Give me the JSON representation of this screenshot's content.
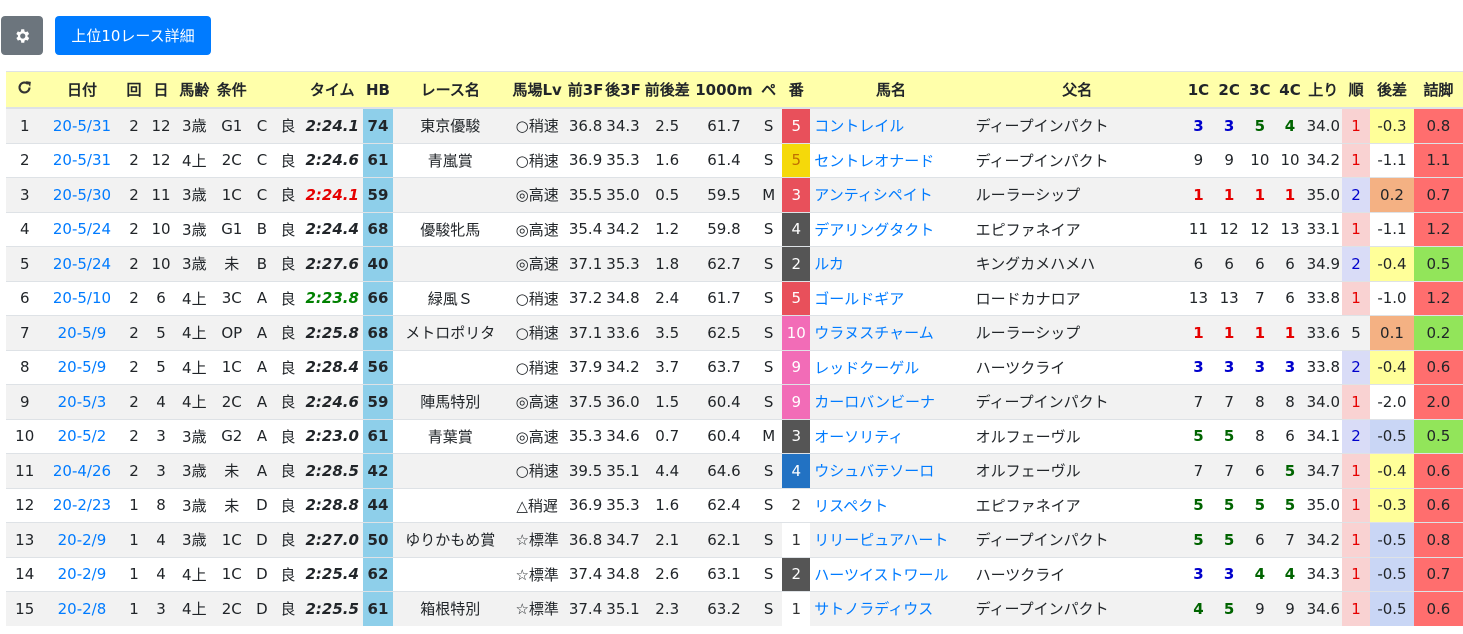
{
  "toolbar": {
    "settings_icon": "gear-icon",
    "top10_label": "上位10レース詳細"
  },
  "colors": {
    "header_bg": "#ffffaa",
    "hb_bg": "#8ecfea",
    "primary": "#007bff",
    "secondary": "#6c757d",
    "waku": {
      "1": "#ffffff",
      "2": "#555555",
      "3": "#e8505b",
      "4": "#2272c3",
      "5": "#f5d90a",
      "6": "#2e9e3f",
      "7": "#f59a1e",
      "8": "#f26cb7"
    }
  },
  "table": {
    "headers": [
      "",
      "日付",
      "回",
      "日",
      "馬齢",
      "条件",
      "",
      "",
      "タイム",
      "HB",
      "レース名",
      "馬場Lv",
      "前3F",
      "後3F",
      "前後差",
      "1000m",
      "ペ",
      "番",
      "馬名",
      "父名",
      "1C",
      "2C",
      "3C",
      "4C",
      "上り",
      "順",
      "後差",
      "詰脚"
    ],
    "refresh_icon": "refresh-icon",
    "rows": [
      {
        "no": "1",
        "date": "20-5/31",
        "kai": "2",
        "day": "12",
        "age": "3歳",
        "cond": "G1",
        "cls": "C",
        "track": "良",
        "time": "2:24.1",
        "time_color": "",
        "hb": "74",
        "race": "東京優駿",
        "baba": "○稍速",
        "f3": "36.8",
        "l3": "34.3",
        "diff": "2.5",
        "m1000": "61.7",
        "pace": "S",
        "ban": "5",
        "waku": "3",
        "horse": "コントレイル",
        "sire": "ディープインパクト",
        "c1": "3",
        "c2": "3",
        "c3": "5",
        "c4": "4",
        "cc": [
          "b",
          "b",
          "g",
          "g"
        ],
        "agari": "34.0",
        "jun": "1",
        "sa": "-0.3",
        "sa_color": "#ffff99",
        "tsume": "0.8",
        "tsume_color": "#ff6e6e"
      },
      {
        "no": "2",
        "date": "20-5/31",
        "kai": "2",
        "day": "12",
        "age": "4上",
        "cond": "2C",
        "cls": "C",
        "track": "良",
        "time": "2:24.6",
        "time_color": "",
        "hb": "61",
        "race": "青嵐賞",
        "baba": "○稍速",
        "f3": "36.9",
        "l3": "35.3",
        "diff": "1.6",
        "m1000": "61.4",
        "pace": "S",
        "ban": "5",
        "waku": "5",
        "horse": "セントレオナード",
        "sire": "ディープインパクト",
        "c1": "9",
        "c2": "9",
        "c3": "10",
        "c4": "10",
        "cc": [
          "",
          "",
          "",
          ""
        ],
        "agari": "34.2",
        "jun": "1",
        "sa": "-1.1",
        "sa_color": "#ffffff",
        "tsume": "1.1",
        "tsume_color": "#ff6e6e"
      },
      {
        "no": "3",
        "date": "20-5/30",
        "kai": "2",
        "day": "11",
        "age": "3歳",
        "cond": "1C",
        "cls": "C",
        "track": "良",
        "time": "2:24.1",
        "time_color": "red",
        "hb": "59",
        "race": "",
        "baba": "◎高速",
        "f3": "35.5",
        "l3": "35.0",
        "diff": "0.5",
        "m1000": "59.5",
        "pace": "M",
        "ban": "3",
        "waku": "3",
        "horse": "アンティシペイト",
        "sire": "ルーラーシップ",
        "c1": "1",
        "c2": "1",
        "c3": "1",
        "c4": "1",
        "cc": [
          "r",
          "r",
          "r",
          "r"
        ],
        "agari": "35.0",
        "jun": "2",
        "sa": "0.2",
        "sa_color": "#f4b183",
        "tsume": "0.7",
        "tsume_color": "#ff6e6e"
      },
      {
        "no": "4",
        "date": "20-5/24",
        "kai": "2",
        "day": "10",
        "age": "3歳",
        "cond": "G1",
        "cls": "B",
        "track": "良",
        "time": "2:24.4",
        "time_color": "",
        "hb": "68",
        "race": "優駿牝馬",
        "baba": "◎高速",
        "f3": "35.4",
        "l3": "34.2",
        "diff": "1.2",
        "m1000": "59.8",
        "pace": "S",
        "ban": "4",
        "waku": "2",
        "horse": "デアリングタクト",
        "sire": "エピファネイア",
        "c1": "11",
        "c2": "12",
        "c3": "12",
        "c4": "13",
        "cc": [
          "",
          "",
          "",
          ""
        ],
        "agari": "33.1",
        "jun": "1",
        "sa": "-1.1",
        "sa_color": "#ffffff",
        "tsume": "1.2",
        "tsume_color": "#ff6e6e"
      },
      {
        "no": "5",
        "date": "20-5/24",
        "kai": "2",
        "day": "10",
        "age": "3歳",
        "cond": "未",
        "cls": "B",
        "track": "良",
        "time": "2:27.6",
        "time_color": "",
        "hb": "40",
        "race": "",
        "baba": "◎高速",
        "f3": "37.1",
        "l3": "35.3",
        "diff": "1.8",
        "m1000": "62.7",
        "pace": "S",
        "ban": "2",
        "waku": "2",
        "horse": "ルカ",
        "sire": "キングカメハメハ",
        "c1": "6",
        "c2": "6",
        "c3": "6",
        "c4": "6",
        "cc": [
          "",
          "",
          "",
          ""
        ],
        "agari": "34.9",
        "jun": "2",
        "sa": "-0.4",
        "sa_color": "#ffff99",
        "tsume": "0.5",
        "tsume_color": "#92e55a"
      },
      {
        "no": "6",
        "date": "20-5/10",
        "kai": "2",
        "day": "6",
        "age": "4上",
        "cond": "3C",
        "cls": "A",
        "track": "良",
        "time": "2:23.8",
        "time_color": "green",
        "hb": "66",
        "race": "緑風Ｓ",
        "baba": "○稍速",
        "f3": "37.2",
        "l3": "34.8",
        "diff": "2.4",
        "m1000": "61.7",
        "pace": "S",
        "ban": "5",
        "waku": "3",
        "horse": "ゴールドギア",
        "sire": "ロードカナロア",
        "c1": "13",
        "c2": "13",
        "c3": "7",
        "c4": "6",
        "cc": [
          "",
          "",
          "",
          ""
        ],
        "agari": "33.8",
        "jun": "1",
        "sa": "-1.0",
        "sa_color": "#ffffff",
        "tsume": "1.2",
        "tsume_color": "#ff6e6e"
      },
      {
        "no": "7",
        "date": "20-5/9",
        "kai": "2",
        "day": "5",
        "age": "4上",
        "cond": "OP",
        "cls": "A",
        "track": "良",
        "time": "2:25.8",
        "time_color": "",
        "hb": "68",
        "race": "メトロポリタ",
        "baba": "○稍速",
        "f3": "37.1",
        "l3": "33.6",
        "diff": "3.5",
        "m1000": "62.5",
        "pace": "S",
        "ban": "10",
        "waku": "8",
        "horse": "ウラヌスチャーム",
        "sire": "ルーラーシップ",
        "c1": "1",
        "c2": "1",
        "c3": "1",
        "c4": "1",
        "cc": [
          "r",
          "r",
          "r",
          "r"
        ],
        "agari": "33.6",
        "jun": "5",
        "sa": "0.1",
        "sa_color": "#f4b183",
        "tsume": "0.2",
        "tsume_color": "#92e55a"
      },
      {
        "no": "8",
        "date": "20-5/9",
        "kai": "2",
        "day": "5",
        "age": "4上",
        "cond": "1C",
        "cls": "A",
        "track": "良",
        "time": "2:28.4",
        "time_color": "",
        "hb": "56",
        "race": "",
        "baba": "○稍速",
        "f3": "37.9",
        "l3": "34.2",
        "diff": "3.7",
        "m1000": "63.7",
        "pace": "S",
        "ban": "9",
        "waku": "8",
        "horse": "レッドクーゲル",
        "sire": "ハーツクライ",
        "c1": "3",
        "c2": "3",
        "c3": "3",
        "c4": "3",
        "cc": [
          "b",
          "b",
          "b",
          "b"
        ],
        "agari": "33.8",
        "jun": "2",
        "sa": "-0.4",
        "sa_color": "#ffff99",
        "tsume": "0.6",
        "tsume_color": "#ff6e6e"
      },
      {
        "no": "9",
        "date": "20-5/3",
        "kai": "2",
        "day": "4",
        "age": "4上",
        "cond": "2C",
        "cls": "A",
        "track": "良",
        "time": "2:24.6",
        "time_color": "",
        "hb": "59",
        "race": "陣馬特別",
        "baba": "◎高速",
        "f3": "37.5",
        "l3": "36.0",
        "diff": "1.5",
        "m1000": "60.4",
        "pace": "S",
        "ban": "9",
        "waku": "8",
        "horse": "カーロバンビーナ",
        "sire": "ディープインパクト",
        "c1": "7",
        "c2": "7",
        "c3": "8",
        "c4": "8",
        "cc": [
          "",
          "",
          "",
          ""
        ],
        "agari": "34.0",
        "jun": "1",
        "sa": "-2.0",
        "sa_color": "#ffffff",
        "tsume": "2.0",
        "tsume_color": "#ff6e6e"
      },
      {
        "no": "10",
        "date": "20-5/2",
        "kai": "2",
        "day": "3",
        "age": "3歳",
        "cond": "G2",
        "cls": "A",
        "track": "良",
        "time": "2:23.0",
        "time_color": "",
        "hb": "61",
        "race": "青葉賞",
        "baba": "◎高速",
        "f3": "35.3",
        "l3": "34.6",
        "diff": "0.7",
        "m1000": "60.4",
        "pace": "M",
        "ban": "3",
        "waku": "2",
        "horse": "オーソリティ",
        "sire": "オルフェーヴル",
        "c1": "5",
        "c2": "5",
        "c3": "8",
        "c4": "6",
        "cc": [
          "g",
          "g",
          "",
          ""
        ],
        "agari": "34.1",
        "jun": "2",
        "sa": "-0.5",
        "sa_color": "#c9d6f5",
        "tsume": "0.5",
        "tsume_color": "#92e55a"
      },
      {
        "no": "11",
        "date": "20-4/26",
        "kai": "2",
        "day": "3",
        "age": "3歳",
        "cond": "未",
        "cls": "A",
        "track": "良",
        "time": "2:28.5",
        "time_color": "",
        "hb": "42",
        "race": "",
        "baba": "○稍速",
        "f3": "39.5",
        "l3": "35.1",
        "diff": "4.4",
        "m1000": "64.6",
        "pace": "S",
        "ban": "4",
        "waku": "4",
        "horse": "ウシュバテソーロ",
        "sire": "オルフェーヴル",
        "c1": "7",
        "c2": "7",
        "c3": "6",
        "c4": "5",
        "cc": [
          "",
          "",
          "",
          "g"
        ],
        "agari": "34.7",
        "jun": "1",
        "sa": "-0.4",
        "sa_color": "#ffff99",
        "tsume": "0.6",
        "tsume_color": "#ff6e6e"
      },
      {
        "no": "12",
        "date": "20-2/23",
        "kai": "1",
        "day": "8",
        "age": "3歳",
        "cond": "未",
        "cls": "D",
        "track": "良",
        "time": "2:28.8",
        "time_color": "",
        "hb": "44",
        "race": "",
        "baba": "△稍遅",
        "f3": "36.9",
        "l3": "35.3",
        "diff": "1.6",
        "m1000": "62.4",
        "pace": "S",
        "ban": "2",
        "waku": "1",
        "horse": "リスペクト",
        "sire": "エピファネイア",
        "c1": "5",
        "c2": "5",
        "c3": "5",
        "c4": "5",
        "cc": [
          "g",
          "g",
          "g",
          "g"
        ],
        "agari": "35.0",
        "jun": "1",
        "sa": "-0.3",
        "sa_color": "#ffff99",
        "tsume": "0.6",
        "tsume_color": "#ff6e6e"
      },
      {
        "no": "13",
        "date": "20-2/9",
        "kai": "1",
        "day": "4",
        "age": "3歳",
        "cond": "1C",
        "cls": "D",
        "track": "良",
        "time": "2:27.0",
        "time_color": "",
        "hb": "50",
        "race": "ゆりかもめ賞",
        "baba": "☆標準",
        "f3": "36.8",
        "l3": "34.7",
        "diff": "2.1",
        "m1000": "62.1",
        "pace": "S",
        "ban": "1",
        "waku": "1",
        "horse": "リリーピュアハート",
        "sire": "ディープインパクト",
        "c1": "5",
        "c2": "5",
        "c3": "6",
        "c4": "7",
        "cc": [
          "g",
          "g",
          "",
          ""
        ],
        "agari": "34.2",
        "jun": "1",
        "sa": "-0.5",
        "sa_color": "#c9d6f5",
        "tsume": "0.8",
        "tsume_color": "#ff6e6e"
      },
      {
        "no": "14",
        "date": "20-2/9",
        "kai": "1",
        "day": "4",
        "age": "4上",
        "cond": "1C",
        "cls": "D",
        "track": "良",
        "time": "2:25.4",
        "time_color": "",
        "hb": "62",
        "race": "",
        "baba": "☆標準",
        "f3": "37.4",
        "l3": "34.8",
        "diff": "2.6",
        "m1000": "63.1",
        "pace": "S",
        "ban": "2",
        "waku": "2",
        "horse": "ハーツイストワール",
        "sire": "ハーツクライ",
        "c1": "3",
        "c2": "3",
        "c3": "4",
        "c4": "4",
        "cc": [
          "b",
          "b",
          "g",
          "g"
        ],
        "agari": "34.3",
        "jun": "1",
        "sa": "-0.5",
        "sa_color": "#c9d6f5",
        "tsume": "0.7",
        "tsume_color": "#ff6e6e"
      },
      {
        "no": "15",
        "date": "20-2/8",
        "kai": "1",
        "day": "3",
        "age": "4上",
        "cond": "2C",
        "cls": "D",
        "track": "良",
        "time": "2:25.5",
        "time_color": "",
        "hb": "61",
        "race": "箱根特別",
        "baba": "☆標準",
        "f3": "37.4",
        "l3": "35.1",
        "diff": "2.3",
        "m1000": "63.2",
        "pace": "S",
        "ban": "1",
        "waku": "1",
        "horse": "サトノラディウス",
        "sire": "ディープインパクト",
        "c1": "4",
        "c2": "5",
        "c3": "9",
        "c4": "9",
        "cc": [
          "g",
          "g",
          "",
          ""
        ],
        "agari": "34.6",
        "jun": "1",
        "sa": "-0.5",
        "sa_color": "#c9d6f5",
        "tsume": "0.6",
        "tsume_color": "#ff6e6e"
      }
    ]
  }
}
